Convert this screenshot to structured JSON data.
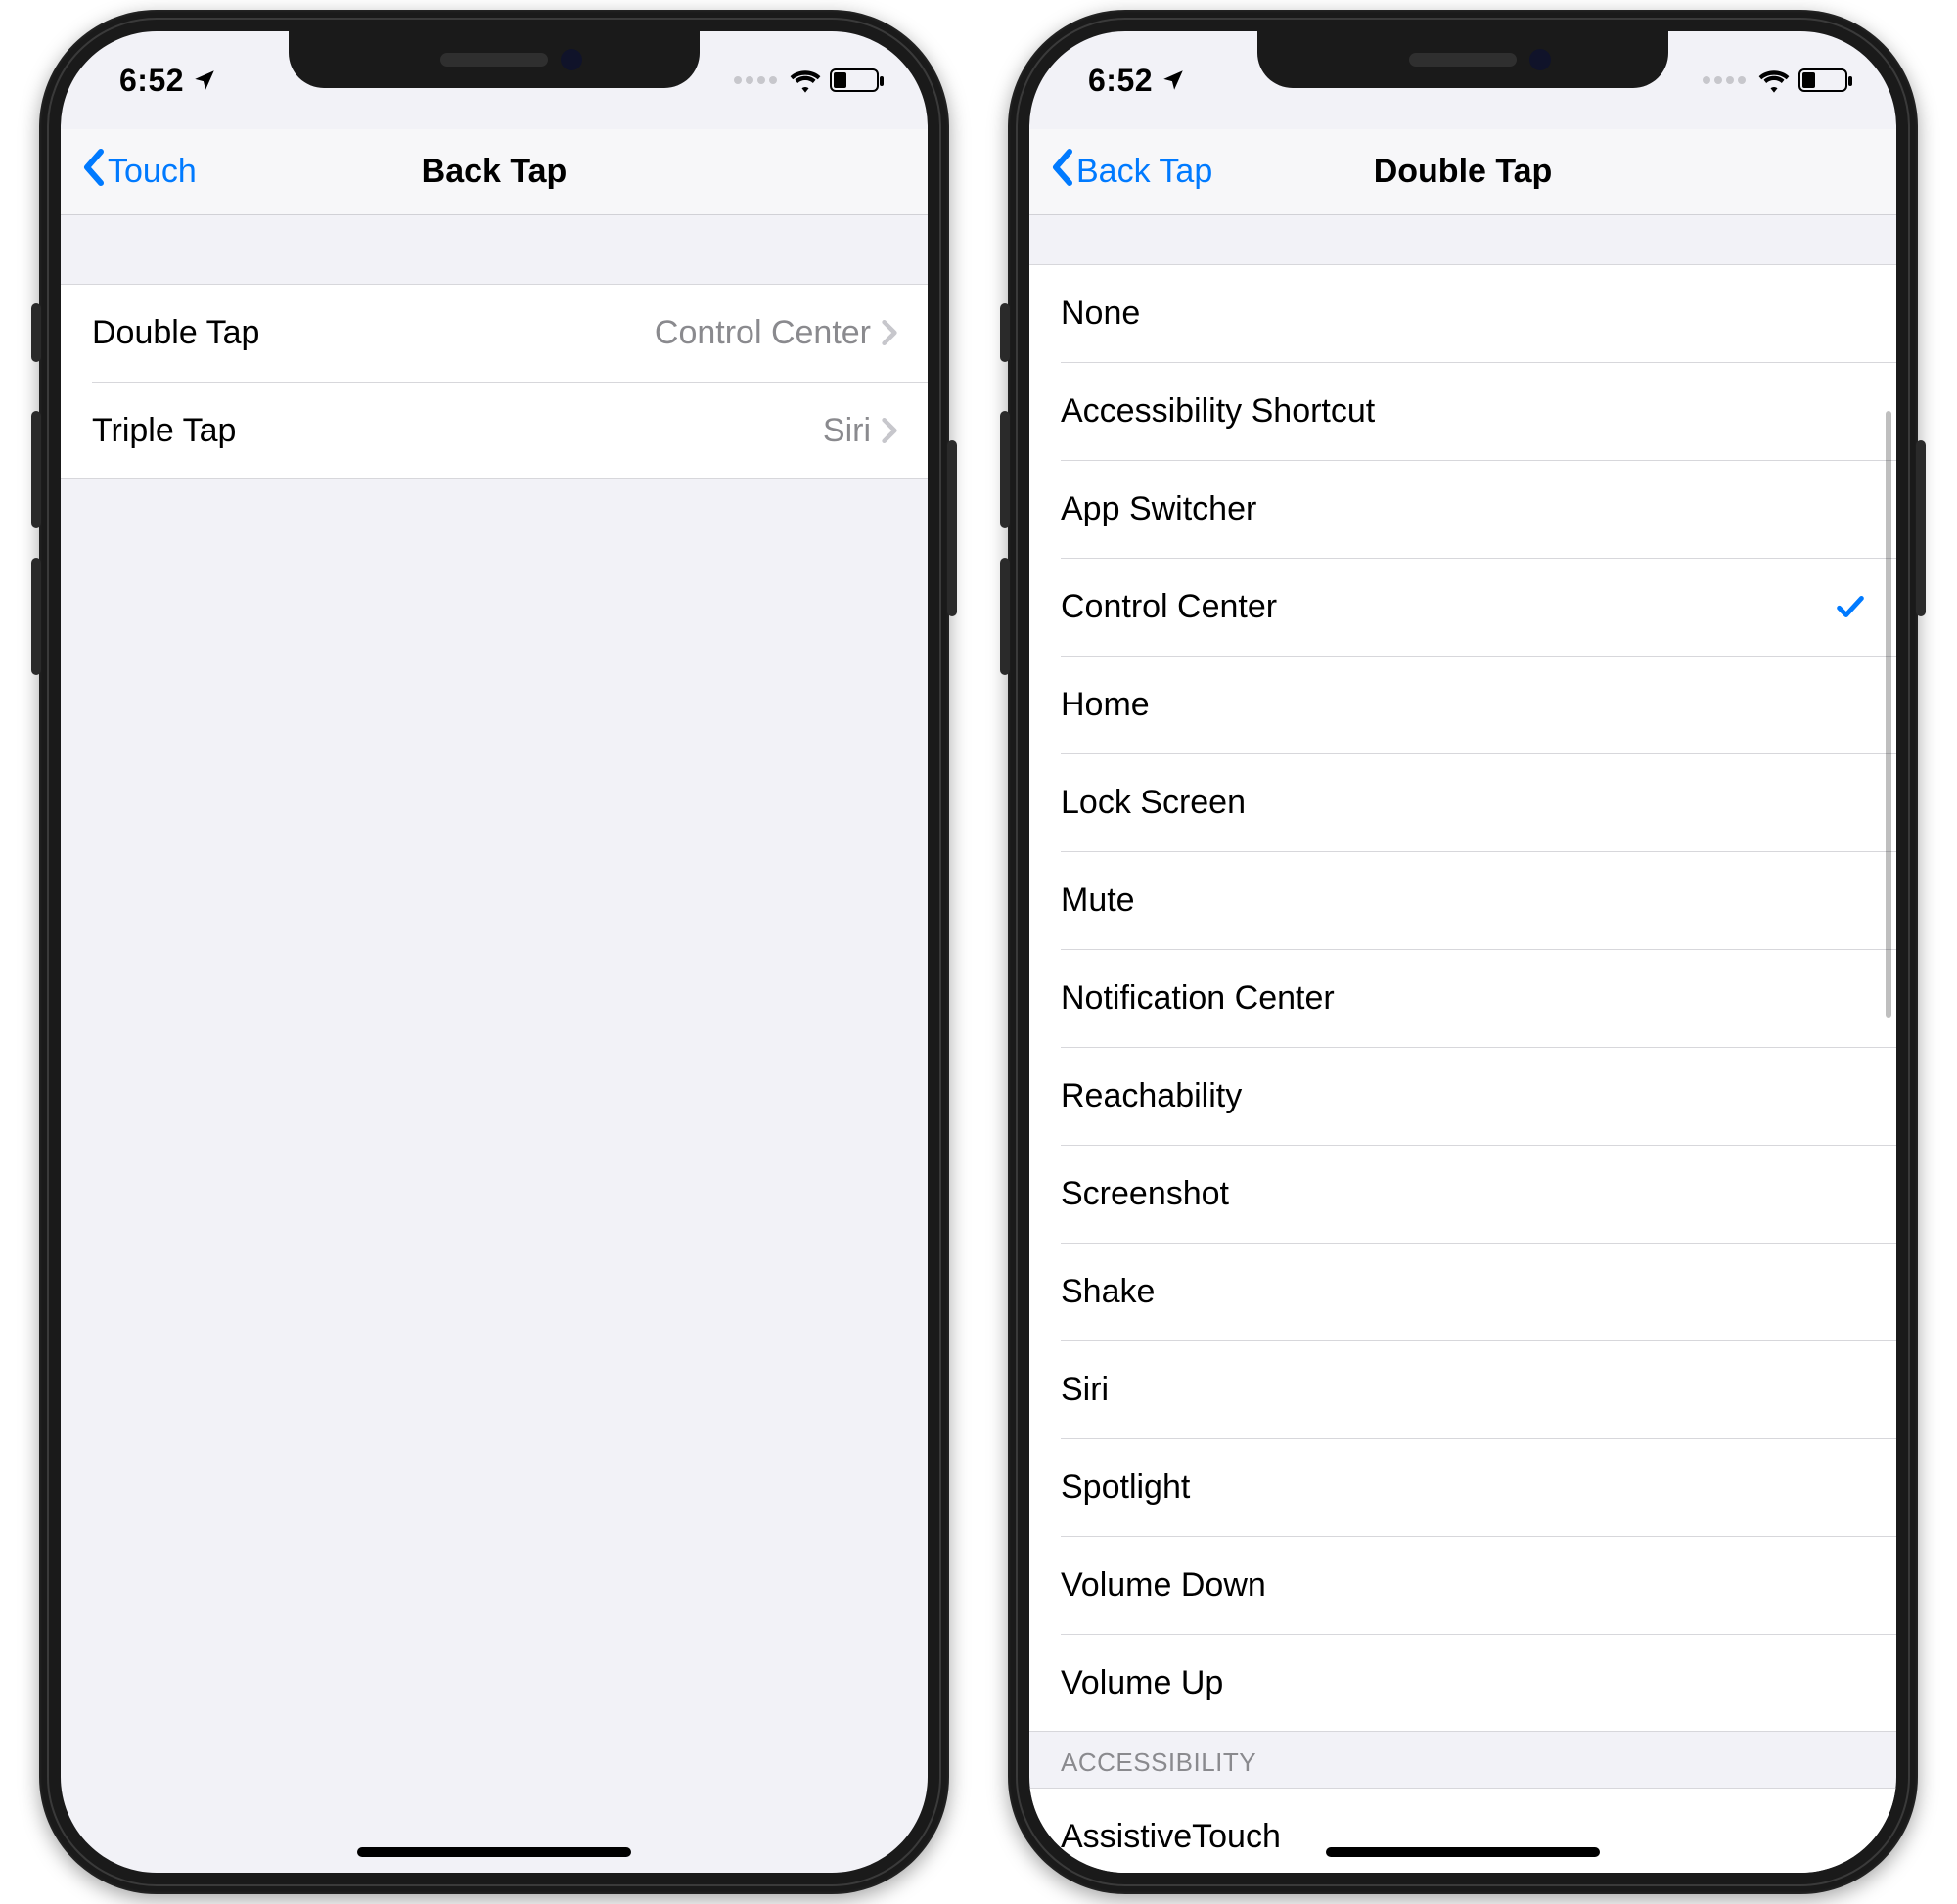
{
  "status": {
    "time": "6:52",
    "location_icon": "location-arrow",
    "dots": 4,
    "wifi": true,
    "battery_pct": 28
  },
  "phones": {
    "left": {
      "back_label": "Touch",
      "title": "Back Tap",
      "rows": [
        {
          "label": "Double Tap",
          "value": "Control Center"
        },
        {
          "label": "Triple Tap",
          "value": "Siri"
        }
      ]
    },
    "right": {
      "back_label": "Back Tap",
      "title": "Double Tap",
      "options": [
        {
          "label": "None",
          "selected": false
        },
        {
          "label": "Accessibility Shortcut",
          "selected": false
        },
        {
          "label": "App Switcher",
          "selected": false
        },
        {
          "label": "Control Center",
          "selected": true
        },
        {
          "label": "Home",
          "selected": false
        },
        {
          "label": "Lock Screen",
          "selected": false
        },
        {
          "label": "Mute",
          "selected": false
        },
        {
          "label": "Notification Center",
          "selected": false
        },
        {
          "label": "Reachability",
          "selected": false
        },
        {
          "label": "Screenshot",
          "selected": false
        },
        {
          "label": "Shake",
          "selected": false
        },
        {
          "label": "Siri",
          "selected": false
        },
        {
          "label": "Spotlight",
          "selected": false
        },
        {
          "label": "Volume Down",
          "selected": false
        },
        {
          "label": "Volume Up",
          "selected": false
        }
      ],
      "section2_header": "Accessibility",
      "section2_options": [
        {
          "label": "AssistiveTouch",
          "selected": false
        }
      ]
    }
  },
  "colors": {
    "tint": "#007aff",
    "bg": "#f2f2f7",
    "separator": "#d7d7db",
    "secondary_text": "#8a8a8e"
  }
}
